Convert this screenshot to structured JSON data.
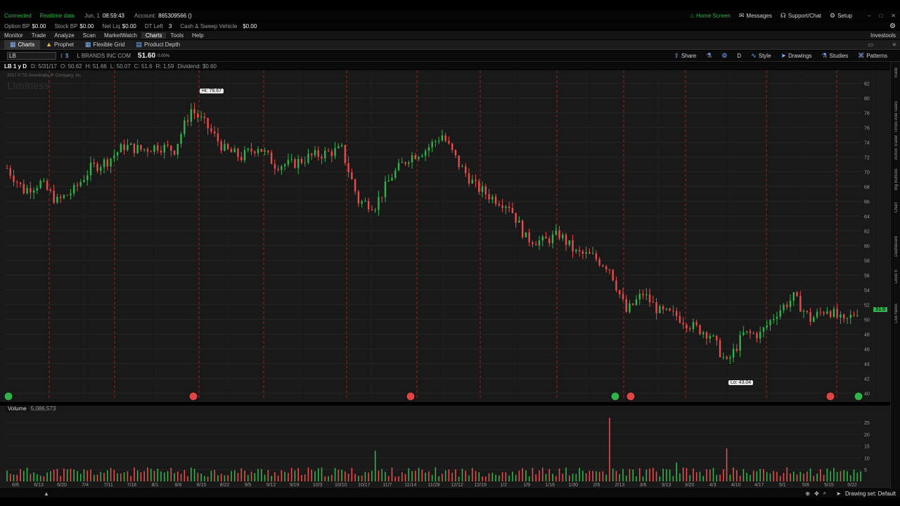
{
  "status": {
    "connection": "Connected",
    "data_mode": "Realtime data",
    "date": "Jun, 1",
    "time": "08:59:43",
    "account_label": "Account:",
    "account_number": "865309566 ()",
    "home_screen": "Home Screen",
    "messages": "Messages",
    "support": "Support/Chat",
    "setup": "Setup"
  },
  "balances": {
    "option_bp_label": "Option BP",
    "option_bp": "$0.00",
    "stock_bp_label": "Stock BP",
    "stock_bp": "$0.00",
    "net_liq_label": "Net Liq",
    "net_liq": "$0.00",
    "dt_left_label": "DT Left",
    "dt_left": "3",
    "cash_label": "Cash & Sweep Vehicle",
    "cash": "$0.00"
  },
  "menu": {
    "items": [
      "Monitor",
      "Trade",
      "Analyze",
      "Scan",
      "MarketWatch",
      "Charts",
      "Tools",
      "Help"
    ],
    "active": "Charts",
    "right_link": "Investools"
  },
  "tabs": {
    "items": [
      "Charts",
      "Prophet",
      "Flexible Grid",
      "Product Depth"
    ]
  },
  "symbol_bar": {
    "symbol": "LB",
    "company": "L BRANDS INC COM",
    "last_price": "51.60",
    "change_pct": "0.00%",
    "tools": [
      "Share",
      "D",
      "Style",
      "Drawings",
      "Studies",
      "Patterns"
    ]
  },
  "info_bar": {
    "chart_id": "LB 1 y D",
    "date": "D: 5/31/17",
    "open": "O: 50.62",
    "high": "H: 51.66",
    "low": "L: 50.07",
    "close": "C: 51.6",
    "range": "R: 1.59",
    "dividend": "Dividend: $0.60"
  },
  "watermark": {
    "copyright": "2017 © TD Ameritrade IP Company, Inc.",
    "brand": "Limitless"
  },
  "chart_data": {
    "type": "candlestick",
    "y_ticks": [
      82,
      80,
      78,
      76,
      74,
      72,
      70,
      68,
      66,
      64,
      62,
      60,
      58,
      56,
      54,
      52,
      50,
      48,
      46,
      44,
      42,
      40
    ],
    "ylim": [
      39,
      83
    ],
    "high_callout": "Hi: 79.67",
    "low_callout": "Lo: 43.04",
    "current_price_tag": "51.6",
    "close_path": [
      {
        "date": "6/6",
        "close": 70.5
      },
      {
        "date": "6/13",
        "close": 67.5
      },
      {
        "date": "6/20",
        "close": 68.5
      },
      {
        "date": "6/27",
        "close": 66.0
      },
      {
        "date": "7/4",
        "close": 67.5
      },
      {
        "date": "7/11",
        "close": 70.5
      },
      {
        "date": "7/18",
        "close": 71.5
      },
      {
        "date": "7/25",
        "close": 73.5
      },
      {
        "date": "8/1",
        "close": 73.0
      },
      {
        "date": "8/8",
        "close": 73.5
      },
      {
        "date": "8/15",
        "close": 73.0
      },
      {
        "date": "8/22",
        "close": 78.5
      },
      {
        "date": "8/29",
        "close": 76.0
      },
      {
        "date": "9/5",
        "close": 73.0
      },
      {
        "date": "9/12",
        "close": 72.0
      },
      {
        "date": "9/19",
        "close": 73.5
      },
      {
        "date": "9/26",
        "close": 71.0
      },
      {
        "date": "10/3",
        "close": 71.0
      },
      {
        "date": "10/10",
        "close": 72.0
      },
      {
        "date": "10/17",
        "close": 72.5
      },
      {
        "date": "10/24",
        "close": 73.0
      },
      {
        "date": "10/31",
        "close": 66.0
      },
      {
        "date": "11/7",
        "close": 65.5
      },
      {
        "date": "11/14",
        "close": 69.5
      },
      {
        "date": "11/21",
        "close": 72.0
      },
      {
        "date": "11/28",
        "close": 73.0
      },
      {
        "date": "12/5",
        "close": 75.0
      },
      {
        "date": "12/12",
        "close": 71.0
      },
      {
        "date": "12/19",
        "close": 68.0
      },
      {
        "date": "12/26",
        "close": 66.5
      },
      {
        "date": "1/2",
        "close": 65.5
      },
      {
        "date": "1/9",
        "close": 61.0
      },
      {
        "date": "1/16",
        "close": 60.5
      },
      {
        "date": "1/23",
        "close": 61.5
      },
      {
        "date": "1/30",
        "close": 59.0
      },
      {
        "date": "2/6",
        "close": 58.5
      },
      {
        "date": "2/13",
        "close": 57.0
      },
      {
        "date": "2/21",
        "close": 51.0
      },
      {
        "date": "2/27",
        "close": 53.5
      },
      {
        "date": "3/6",
        "close": 51.0
      },
      {
        "date": "3/13",
        "close": 50.5
      },
      {
        "date": "3/20",
        "close": 49.0
      },
      {
        "date": "3/27",
        "close": 48.0
      },
      {
        "date": "4/3",
        "close": 44.0
      },
      {
        "date": "4/10",
        "close": 48.0
      },
      {
        "date": "4/17",
        "close": 48.0
      },
      {
        "date": "4/24",
        "close": 51.0
      },
      {
        "date": "5/1",
        "close": 53.0
      },
      {
        "date": "5/8",
        "close": 50.0
      },
      {
        "date": "5/15",
        "close": 51.5
      },
      {
        "date": "5/22",
        "close": 49.5
      },
      {
        "date": "5/31",
        "close": 51.6
      }
    ],
    "x_tick_labels": [
      "6/6",
      "6/13",
      "6/20",
      "7/4",
      "7/11",
      "7/18",
      "8/1",
      "8/8",
      "8/15",
      "8/22",
      "9/5",
      "9/12",
      "9/19",
      "10/3",
      "10/10",
      "10/17",
      "11/7",
      "11/14",
      "11/28",
      "12/12",
      "12/19",
      "1/2",
      "1/9",
      "1/16",
      "1/30",
      "2/6",
      "2/13",
      "3/6",
      "3/13",
      "3/20",
      "4/3",
      "4/10",
      "4/17",
      "5/1",
      "5/8",
      "5/15",
      "5/22"
    ],
    "up_color": "#2fb34a",
    "down_color": "#e84b4b",
    "grid": true
  },
  "volume": {
    "label": "Volume",
    "value": "5,086,573",
    "y_ticks": [
      25,
      20,
      15,
      10,
      5
    ],
    "spikes": [
      {
        "index": 22,
        "value": 13
      },
      {
        "index": 36,
        "value": 27
      },
      {
        "index": 43,
        "value": 14
      },
      {
        "index": 40,
        "value": 8
      }
    ],
    "ylim": [
      0,
      28
    ]
  },
  "right_rail": {
    "labels": [
      "Trade",
      "Times And Sales",
      "Active Trader",
      "Big Buttons",
      "Chart",
      "Dashboard",
      "Level II",
      "Live News"
    ]
  },
  "footer": {
    "drawing_set": "Drawing set: Default"
  }
}
